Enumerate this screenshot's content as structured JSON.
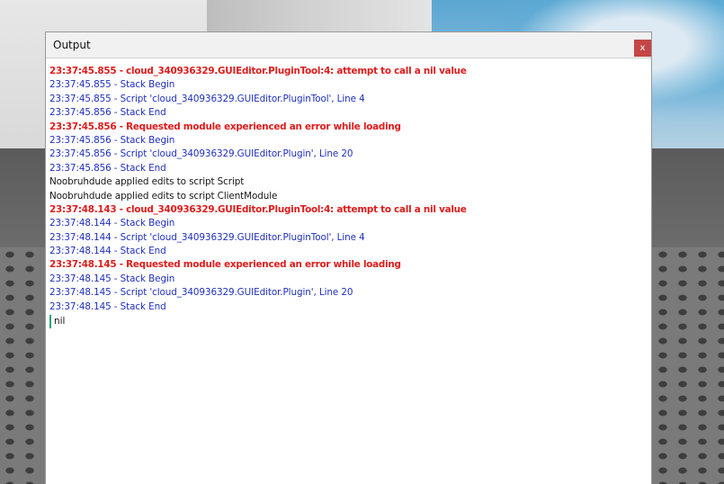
{
  "window": {
    "title": "Output",
    "close_label": "x"
  },
  "log": {
    "lines": [
      {
        "type": "error",
        "text": "23:37:45.855 - cloud_340936329.GUIEditor.PluginTool:4: attempt to call a nil value"
      },
      {
        "type": "info",
        "text": "23:37:45.855 - Stack Begin"
      },
      {
        "type": "info",
        "text": "23:37:45.855 - Script 'cloud_340936329.GUIEditor.PluginTool', Line 4"
      },
      {
        "type": "info",
        "text": "23:37:45.856 - Stack End"
      },
      {
        "type": "error",
        "text": "23:37:45.856 - Requested module experienced an error while loading"
      },
      {
        "type": "info",
        "text": "23:37:45.856 - Stack Begin"
      },
      {
        "type": "info",
        "text": "23:37:45.856 - Script 'cloud_340936329.GUIEditor.Plugin', Line 20"
      },
      {
        "type": "info",
        "text": "23:37:45.856 - Stack End"
      },
      {
        "type": "plain",
        "text": "Noobruhdude applied edits to script Script"
      },
      {
        "type": "plain",
        "text": "Noobruhdude applied edits to script ClientModule"
      },
      {
        "type": "error",
        "text": "23:37:48.143 - cloud_340936329.GUIEditor.PluginTool:4: attempt to call a nil value"
      },
      {
        "type": "info",
        "text": "23:37:48.144 - Stack Begin"
      },
      {
        "type": "info",
        "text": "23:37:48.144 - Script 'cloud_340936329.GUIEditor.PluginTool', Line 4"
      },
      {
        "type": "info",
        "text": "23:37:48.144 - Stack End"
      },
      {
        "type": "error",
        "text": "23:37:48.145 - Requested module experienced an error while loading"
      },
      {
        "type": "info",
        "text": "23:37:48.145 - Stack Begin"
      },
      {
        "type": "info",
        "text": "23:37:48.145 - Script 'cloud_340936329.GUIEditor.Plugin', Line 20"
      },
      {
        "type": "info",
        "text": "23:37:48.145 - Stack End"
      }
    ],
    "input_value": "nil"
  },
  "colors": {
    "error": "#e01b1b",
    "info": "#1f2fbf",
    "plain": "#151515",
    "close_button": "#c44545"
  }
}
